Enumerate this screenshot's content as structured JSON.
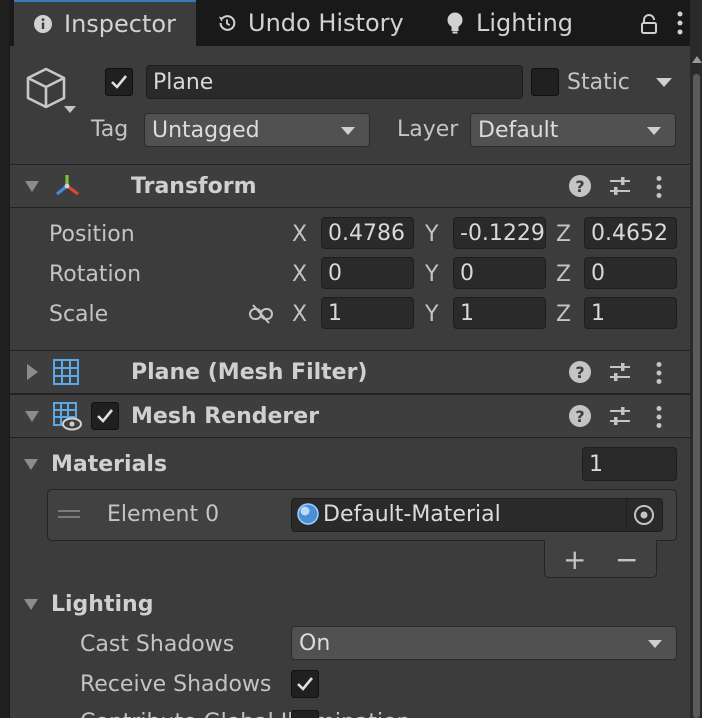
{
  "tabs": [
    {
      "label": "Inspector",
      "icon": "info-icon",
      "active": true
    },
    {
      "label": "Undo History",
      "icon": "history-icon",
      "active": false
    },
    {
      "label": "Lighting",
      "icon": "lightbulb-icon",
      "active": false
    }
  ],
  "object": {
    "name": "Plane",
    "active": true,
    "static_label": "Static",
    "static": false,
    "tag_label": "Tag",
    "tag_value": "Untagged",
    "layer_label": "Layer",
    "layer_value": "Default"
  },
  "transform": {
    "title": "Transform",
    "rows": [
      {
        "label": "Position",
        "x": "0.4786",
        "y": "-0.1229",
        "z": "0.4652"
      },
      {
        "label": "Rotation",
        "x": "0",
        "y": "0",
        "z": "0"
      },
      {
        "label": "Scale",
        "x": "1",
        "y": "1",
        "z": "1"
      }
    ],
    "axis_x": "X",
    "axis_y": "Y",
    "axis_z": "Z"
  },
  "mesh_filter": {
    "title": "Plane (Mesh Filter)"
  },
  "mesh_renderer": {
    "title": "Mesh Renderer",
    "enabled": true,
    "materials_label": "Materials",
    "materials_count": "1",
    "element_label": "Element 0",
    "element_value": "Default-Material",
    "add_label": "+",
    "remove_label": "−",
    "lighting_label": "Lighting",
    "cast_shadows_label": "Cast Shadows",
    "cast_shadows_value": "On",
    "receive_shadows_label": "Receive Shadows",
    "receive_shadows": true,
    "contribute_gi_label": "Contribute Global Illumination"
  },
  "colors": {
    "panel_bg": "#3c3c3c",
    "field_bg": "#2a2a2a",
    "tab_accent": "#3a79bb",
    "transform_x": "#e0453a",
    "transform_y": "#7cc13a",
    "transform_z": "#3f8ee0"
  }
}
